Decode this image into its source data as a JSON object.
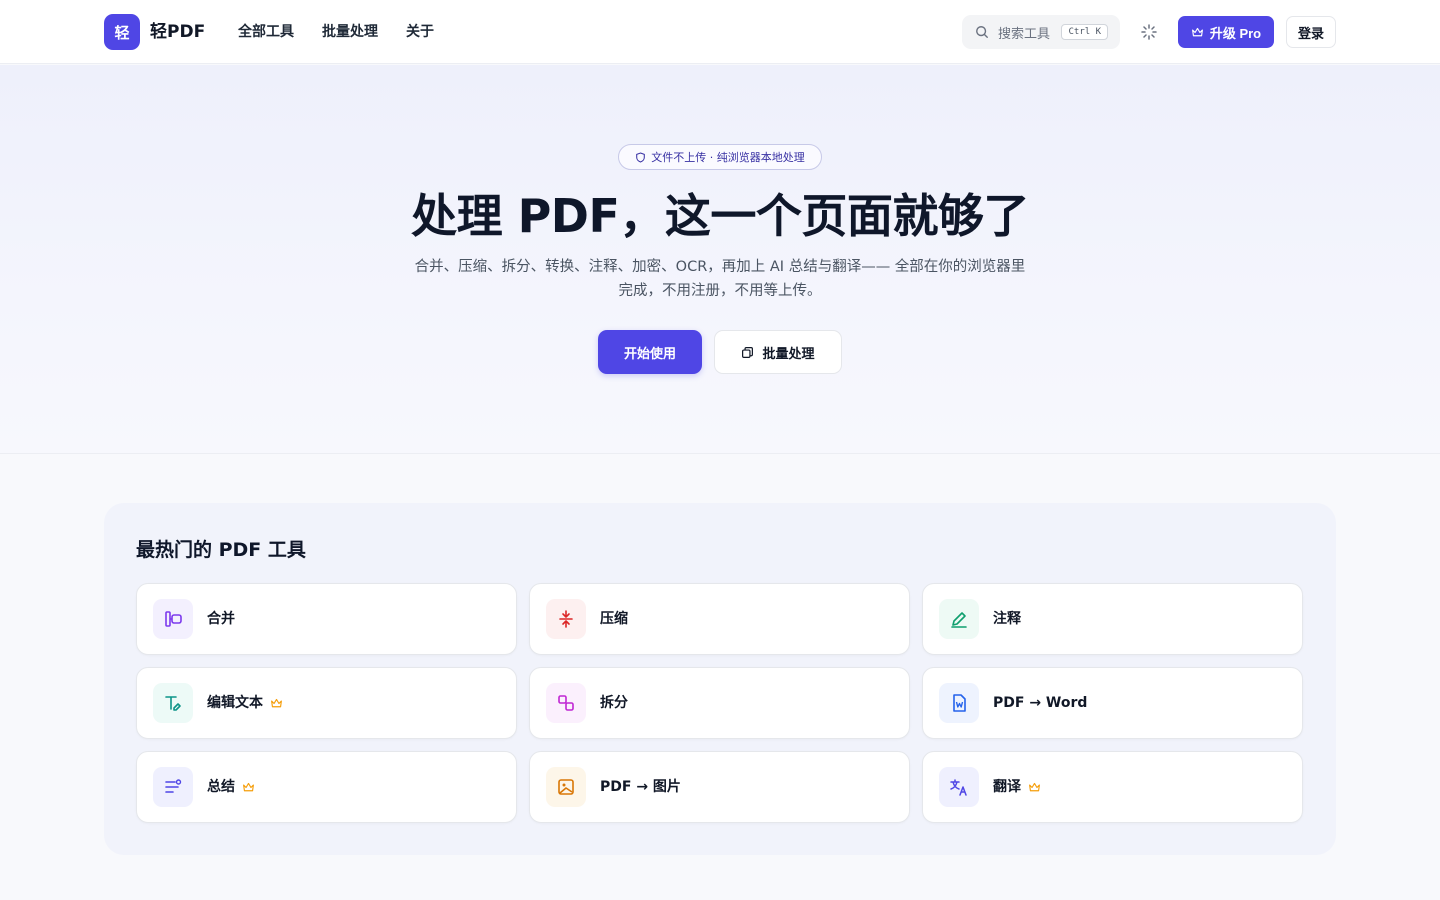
{
  "header": {
    "logo_mark": "轻",
    "logo_text": "轻PDF",
    "nav": [
      "全部工具",
      "批量处理",
      "关于"
    ],
    "search_placeholder": "搜索工具",
    "search_shortcut": "Ctrl K",
    "pro_label": "升级 Pro",
    "login_label": "登录"
  },
  "hero": {
    "badge": "文件不上传 · 纯浏览器本地处理",
    "title": "处理 PDF，这一个页面就够了",
    "subtitle_line1": "合并、压缩、拆分、转换、注释、加密、OCR，再加上 AI 总结与翻译—— 全部在你的浏览器里",
    "subtitle_line2": "完成，不用注册，不用等上传。",
    "start_label": "开始使用",
    "batch_label": "批量处理"
  },
  "tools": {
    "title": "最热门的 PDF 工具",
    "items": [
      {
        "label": "合并",
        "icon": "merge-icon",
        "pro": false,
        "color": "#7c3aed",
        "bg": "#f3f0fe"
      },
      {
        "label": "压缩",
        "icon": "compress-icon",
        "pro": false,
        "color": "#dc2626",
        "bg": "#fdf0f0"
      },
      {
        "label": "注释",
        "icon": "pen-icon",
        "pro": false,
        "color": "#0f9f6e",
        "bg": "#eefaf5"
      },
      {
        "label": "编辑文本",
        "icon": "edit-text-icon",
        "pro": true,
        "color": "#0d9488",
        "bg": "#edfaf7"
      },
      {
        "label": "拆分",
        "icon": "split-icon",
        "pro": false,
        "color": "#c026d3",
        "bg": "#fbf0fd"
      },
      {
        "label": "PDF → Word",
        "icon": "word-file-icon",
        "pro": false,
        "color": "#2563eb",
        "bg": "#eef3fe"
      },
      {
        "label": "总结",
        "icon": "summary-icon",
        "pro": true,
        "color": "#4f46e5",
        "bg": "#eff0fe"
      },
      {
        "label": "PDF → 图片",
        "icon": "image-icon",
        "pro": false,
        "color": "#d97706",
        "bg": "#fdf6e9"
      },
      {
        "label": "翻译",
        "icon": "translate-icon",
        "pro": true,
        "color": "#4f46e5",
        "bg": "#eff0fe"
      }
    ]
  },
  "colors": {
    "accent": "#4f46e5",
    "pro_crown": "#f59e0b"
  }
}
